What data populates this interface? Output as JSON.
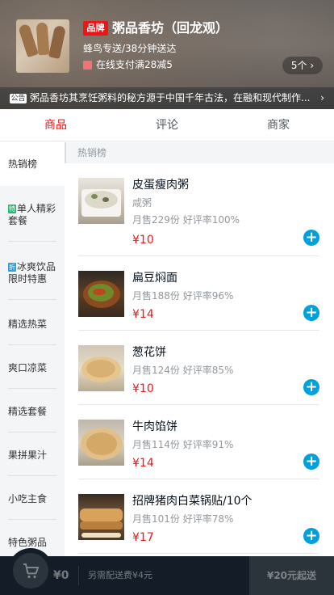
{
  "seller": {
    "brand_badge": "品牌",
    "name": "粥品香坊（回龙观）",
    "delivery": "蜂鸟专送/38分钟送达",
    "promo": "在线支付满28减5",
    "promo_count": "5个 ›",
    "notice_badge": "公告",
    "notice": "粥品香坊其烹饪粥料的秘方源于中国千年古法，在融和现代制作...",
    "notice_arrow": "›"
  },
  "tabs": [
    {
      "label": "商品"
    },
    {
      "label": "评论"
    },
    {
      "label": "商家"
    }
  ],
  "menu": [
    {
      "label": "热销榜"
    },
    {
      "label": "单人精彩套餐",
      "icon": "特"
    },
    {
      "label": "冰爽饮品限时特惠",
      "icon": "折"
    },
    {
      "label": "精选热菜"
    },
    {
      "label": "爽口凉菜"
    },
    {
      "label": "精选套餐"
    },
    {
      "label": "果拼果汁"
    },
    {
      "label": "小吃主食"
    },
    {
      "label": "特色粥品"
    }
  ],
  "section_title": "热销榜",
  "foods": [
    {
      "name": "皮蛋瘦肉粥",
      "desc": "咸粥",
      "sales": "月售229份 好评率100%",
      "price": "¥10"
    },
    {
      "name": "扁豆焖面",
      "desc": "",
      "sales": "月售188份 好评率96%",
      "price": "¥14"
    },
    {
      "name": "葱花饼",
      "desc": "",
      "sales": "月售124份 好评率85%",
      "price": "¥10"
    },
    {
      "name": "牛肉馅饼",
      "desc": "",
      "sales": "月售114份 好评率91%",
      "price": "¥14"
    },
    {
      "name": "招牌猪肉白菜锅贴/10个",
      "desc": "",
      "sales": "月售101份 好评率78%",
      "price": "¥17"
    }
  ],
  "cart": {
    "price": "¥0",
    "desc": "另需配送费¥4元",
    "pay": "¥20元起送"
  },
  "colors": {
    "accent_red": "#f01414",
    "add_blue": "#00a0dc",
    "cart_bg": "#141d27"
  }
}
